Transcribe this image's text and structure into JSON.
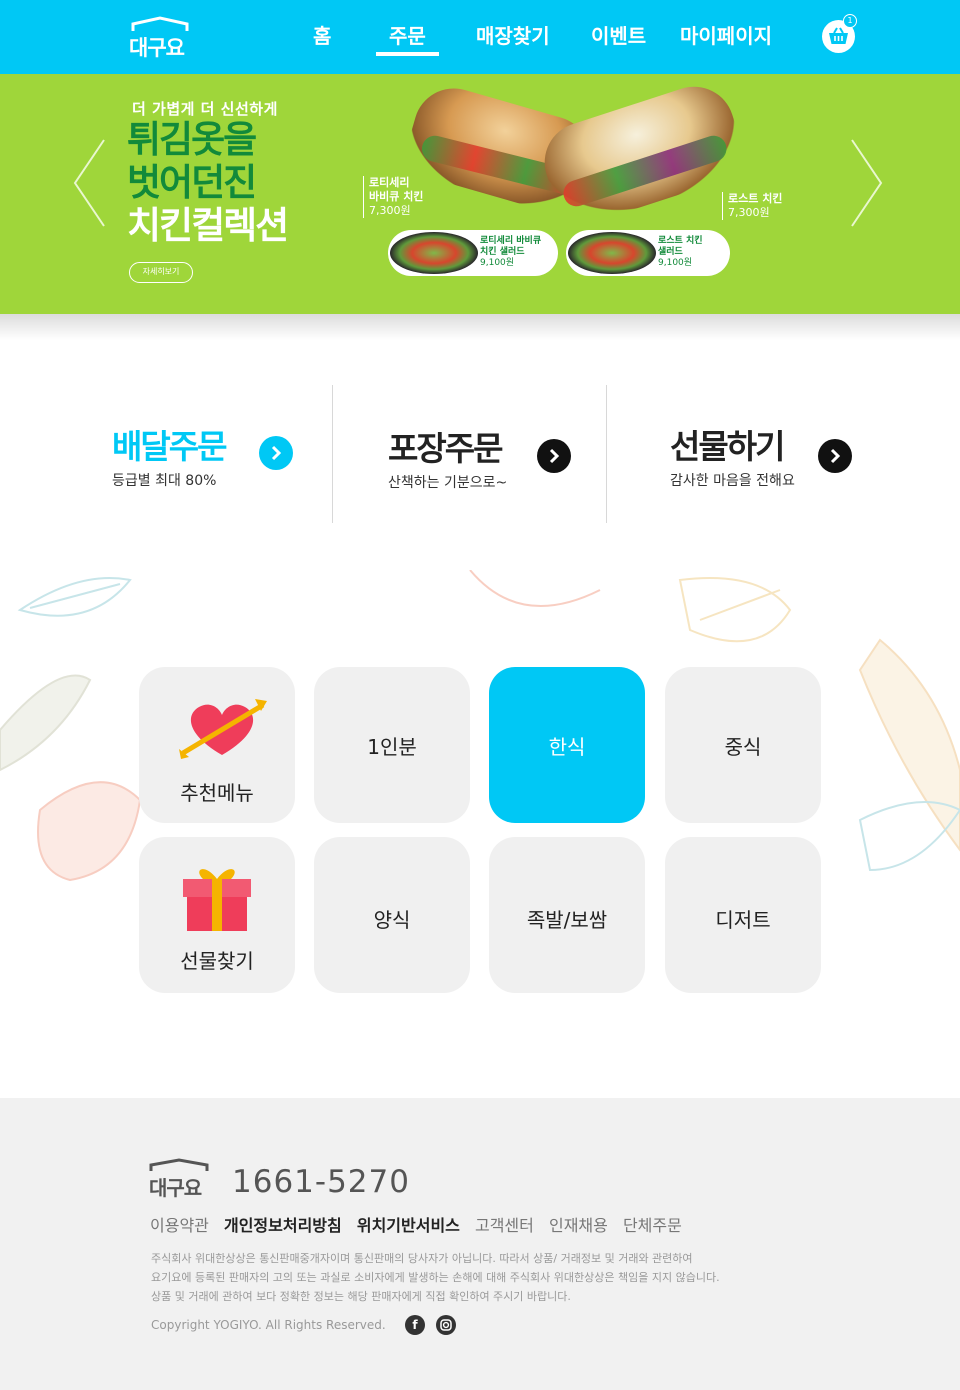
{
  "header": {
    "logo": "대구요",
    "nav": [
      "홈",
      "주문",
      "매장찾기",
      "이벤트",
      "마이페이지"
    ],
    "active_nav": "주문",
    "cart_count": "1",
    "bg_color": "#00c8f5"
  },
  "banner": {
    "sub": "더 가볍게 더 신선하게",
    "title_line1": "튀김옷을",
    "title_line2": "벗어던진",
    "title_line3": "치킨컬렉션",
    "more": "자세히보기",
    "products": [
      {
        "name1": "로티세리",
        "name2": "바비큐 치킨",
        "price": "7,300원"
      },
      {
        "name1": "로스트 치킨",
        "name2": "",
        "price": "7,300원"
      }
    ],
    "salads": [
      {
        "name1": "로티세리 바비큐",
        "name2": "치킨 샐러드",
        "price": "9,100원"
      },
      {
        "name1": "로스트 치킨",
        "name2": "샐러드",
        "price": "9,100원"
      }
    ],
    "bg_color": "#9fd63a"
  },
  "order": [
    {
      "title": "배달주문",
      "desc": "등급별 최대 80%",
      "color": "#00c8f5"
    },
    {
      "title": "포장주문",
      "desc": "산책하는 기분으로~",
      "color": "#111111"
    },
    {
      "title": "선물하기",
      "desc": "감사한 마음을 전해요",
      "color": "#111111"
    }
  ],
  "categories": [
    {
      "label": "추천메뉴",
      "icon": "heart-arrow-icon",
      "active": false
    },
    {
      "label": "1인분",
      "active": false
    },
    {
      "label": "한식",
      "active": true
    },
    {
      "label": "중식",
      "active": false
    },
    {
      "label": "선물찾기",
      "icon": "gift-icon",
      "active": false
    },
    {
      "label": "양식",
      "active": false
    },
    {
      "label": "족발/보쌈",
      "active": false
    },
    {
      "label": "디저트",
      "active": false
    }
  ],
  "footer": {
    "logo": "대구요",
    "phone": "1661-5270",
    "links": [
      "이용약관",
      "개인정보처리방침",
      "위치기반서비스",
      "고객센터",
      "인재채용",
      "단체주문"
    ],
    "notice": [
      "주식회사 위대한상상은 통신판매중개자이며 통신판매의 당사자가 아닙니다. 따라서 상품/ 거래정보 및 거래와 관련하여",
      "요기요에 등록된 판매자의 고의 또는 과실로 소비자에게 발생하는 손해에 대해 주식회사 위대한상상은 책임을 지지 않습니다.",
      "상품 및 거래에 관하여 보다 정확한 정보는 해당 판매자에게 직접 확인하여 주시기 바랍니다."
    ],
    "copyright": "Copyright YOGIYO. All Rights Reserved.",
    "sns": [
      "facebook-icon",
      "instagram-icon"
    ]
  }
}
